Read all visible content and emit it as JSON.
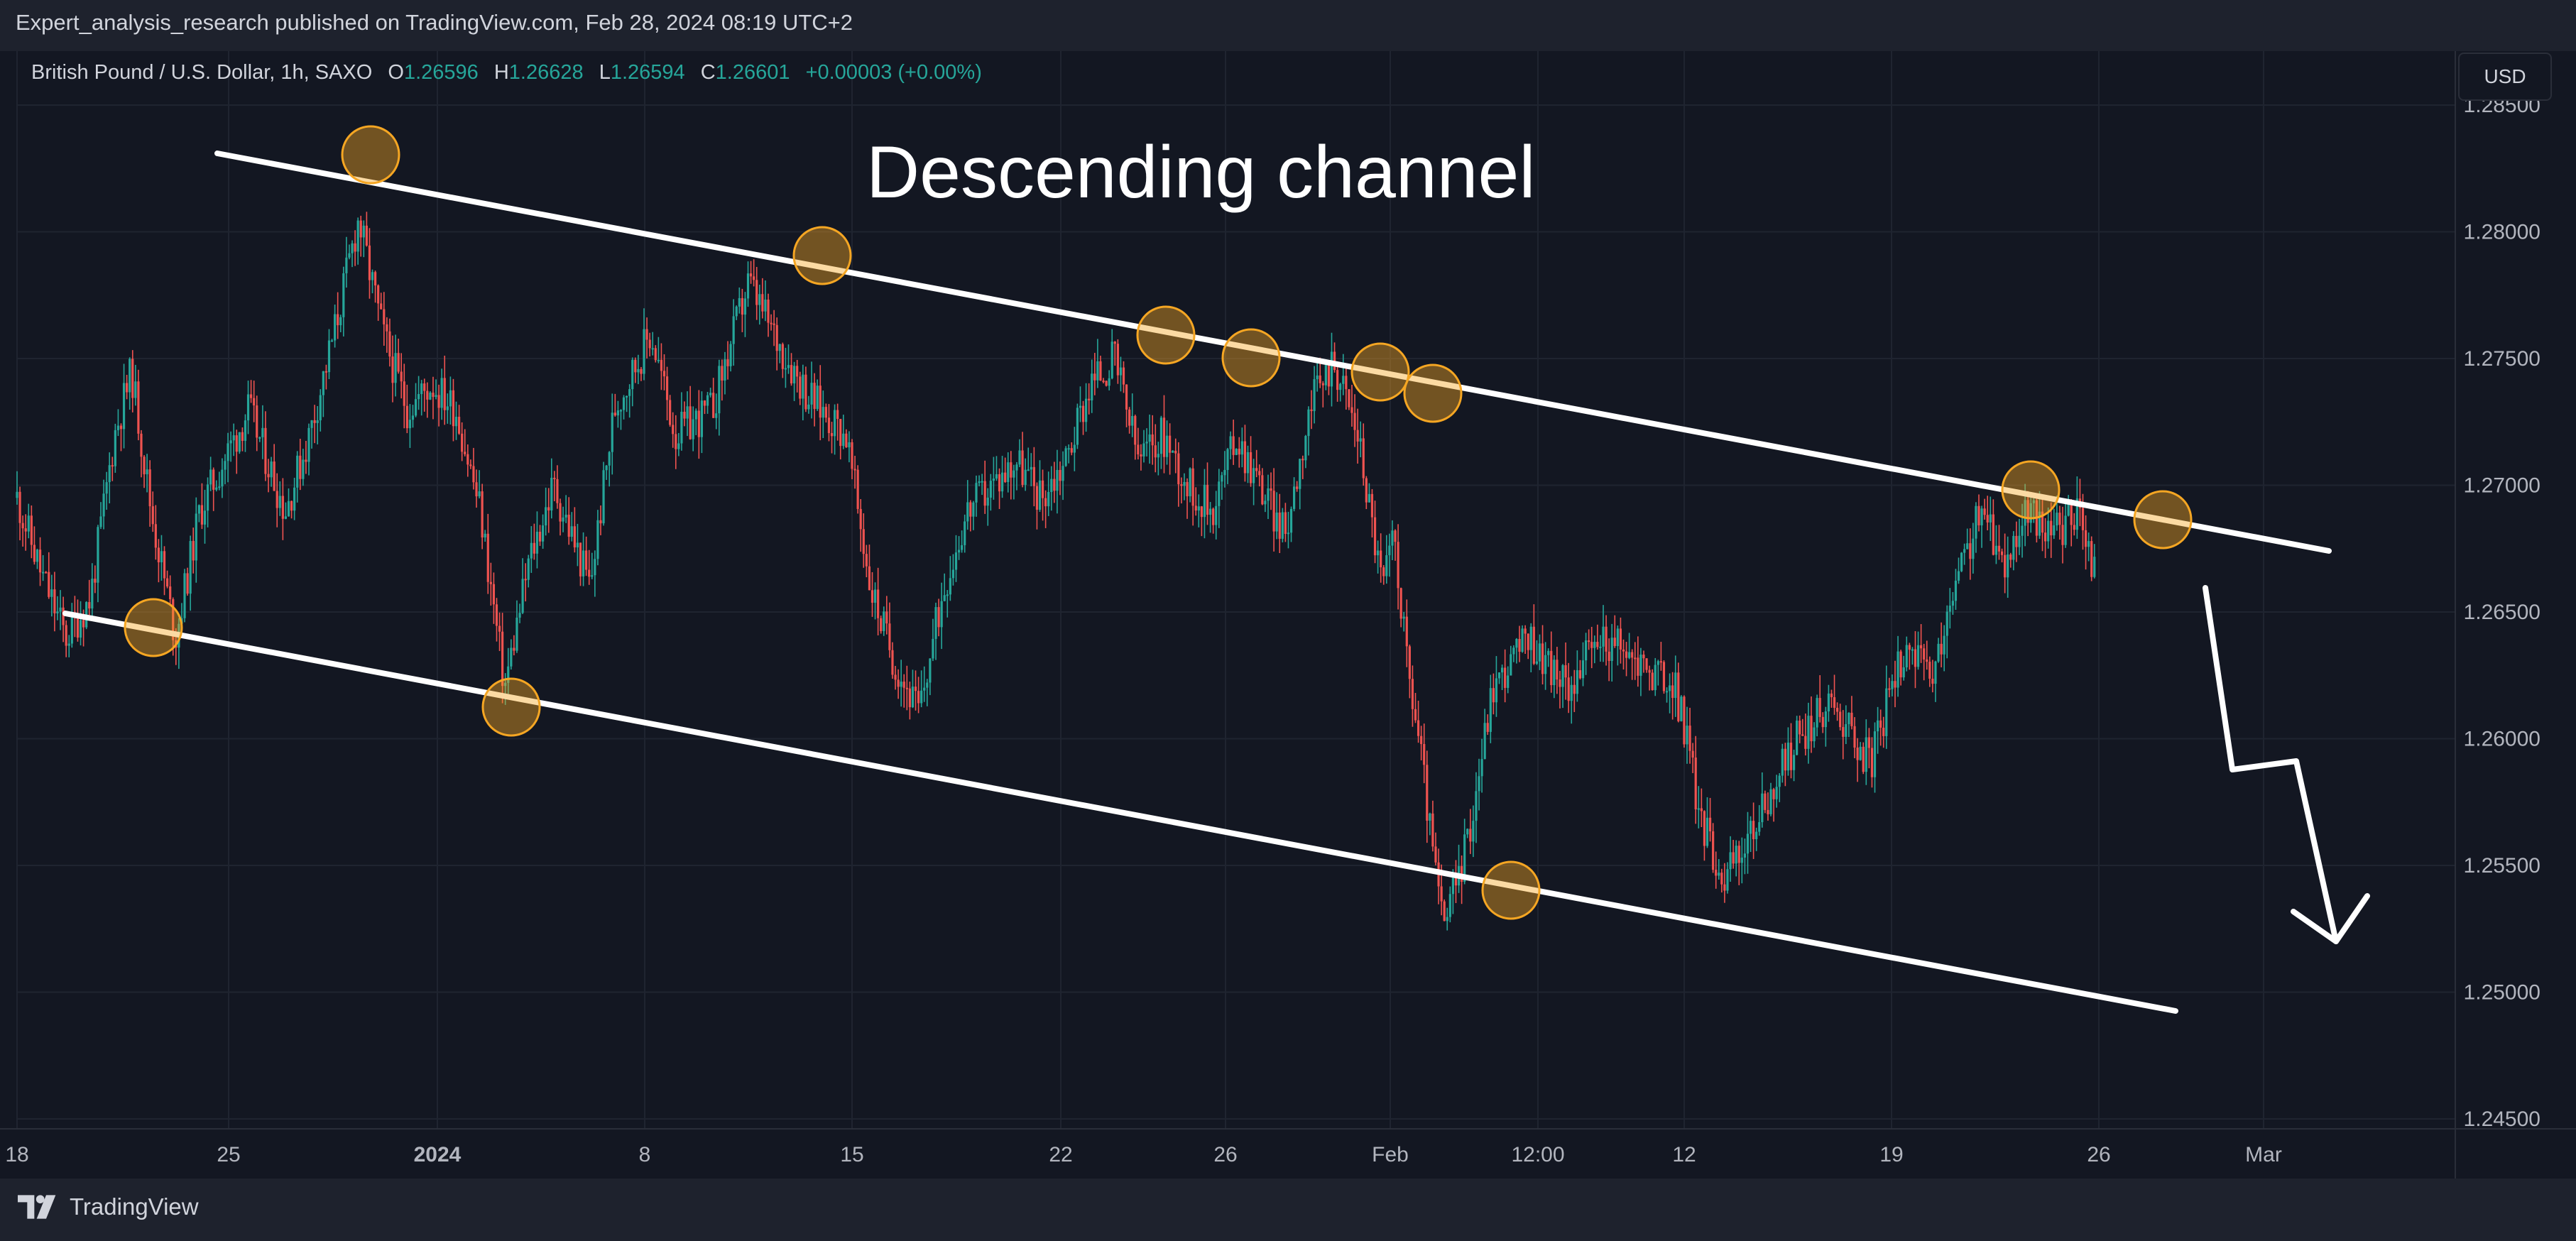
{
  "header": {
    "published": "Expert_analysis_research published on TradingView.com, Feb 28, 2024 08:19 UTC+2"
  },
  "legend": {
    "symbol": "British Pound / U.S. Dollar, 1h, SAXO",
    "open_label": "O",
    "open": "1.26596",
    "high_label": "H",
    "high": "1.26628",
    "low_label": "L",
    "low": "1.26594",
    "close_label": "C",
    "close": "1.26601",
    "change": "+0.00003 (+0.00%)"
  },
  "currency_button": "USD",
  "footer": {
    "brand": "TradingView"
  },
  "colors": {
    "background": "#131722",
    "bar": "#1e222d",
    "grid": "#1f2430",
    "axis_text": "#b2b5be",
    "up": "#26a69a",
    "down": "#ef5350",
    "trendline": "#ffffff",
    "marker": "#f5a623"
  },
  "icons": {
    "brand_logo": "tradingview-logo-icon"
  },
  "chart_data": {
    "type": "candlestick",
    "title": "Descending channel",
    "timeframe": "1h",
    "y_ticks": [
      "1.28500",
      "1.28000",
      "1.27500",
      "1.27000",
      "1.26500",
      "1.26000",
      "1.25500",
      "1.25000",
      "1.24500"
    ],
    "x_ticks": [
      {
        "label": "18",
        "bold": false
      },
      {
        "label": "25",
        "bold": false
      },
      {
        "label": "2024",
        "bold": true
      },
      {
        "label": "8",
        "bold": false
      },
      {
        "label": "15",
        "bold": false
      },
      {
        "label": "22",
        "bold": false
      },
      {
        "label": "26",
        "bold": false
      },
      {
        "label": "Feb",
        "bold": false
      },
      {
        "label": "12:00",
        "bold": false
      },
      {
        "label": "12",
        "bold": false
      },
      {
        "label": "19",
        "bold": false
      },
      {
        "label": "26",
        "bold": false
      },
      {
        "label": "Mar",
        "bold": false
      }
    ],
    "price_path": [
      [
        0,
        1.2695
      ],
      [
        0.01,
        1.2665
      ],
      [
        0.02,
        1.264
      ],
      [
        0.03,
        1.2655
      ],
      [
        0.04,
        1.272
      ],
      [
        0.047,
        1.2745
      ],
      [
        0.055,
        1.269
      ],
      [
        0.065,
        1.264
      ],
      [
        0.075,
        1.269
      ],
      [
        0.085,
        1.271
      ],
      [
        0.095,
        1.273
      ],
      [
        0.11,
        1.269
      ],
      [
        0.12,
        1.272
      ],
      [
        0.13,
        1.276
      ],
      [
        0.14,
        1.2805
      ],
      [
        0.15,
        1.276
      ],
      [
        0.16,
        1.273
      ],
      [
        0.17,
        1.274
      ],
      [
        0.18,
        1.273
      ],
      [
        0.19,
        1.269
      ],
      [
        0.2,
        1.262
      ],
      [
        0.21,
        1.267
      ],
      [
        0.22,
        1.27
      ],
      [
        0.235,
        1.266
      ],
      [
        0.245,
        1.273
      ],
      [
        0.26,
        1.276
      ],
      [
        0.27,
        1.272
      ],
      [
        0.285,
        1.273
      ],
      [
        0.3,
        1.278
      ],
      [
        0.31,
        1.276
      ],
      [
        0.325,
        1.2735
      ],
      [
        0.34,
        1.272
      ],
      [
        0.35,
        1.266
      ],
      [
        0.36,
        1.263
      ],
      [
        0.37,
        1.261
      ],
      [
        0.38,
        1.266
      ],
      [
        0.39,
        1.269
      ],
      [
        0.4,
        1.27
      ],
      [
        0.41,
        1.271
      ],
      [
        0.42,
        1.2695
      ],
      [
        0.43,
        1.271
      ],
      [
        0.44,
        1.274
      ],
      [
        0.45,
        1.275
      ],
      [
        0.46,
        1.271
      ],
      [
        0.47,
        1.272
      ],
      [
        0.48,
        1.27
      ],
      [
        0.49,
        1.269
      ],
      [
        0.5,
        1.272
      ],
      [
        0.51,
        1.27
      ],
      [
        0.52,
        1.268
      ],
      [
        0.53,
        1.273
      ],
      [
        0.54,
        1.275
      ],
      [
        0.55,
        1.272
      ],
      [
        0.56,
        1.266
      ],
      [
        0.565,
        1.268
      ],
      [
        0.57,
        1.263
      ],
      [
        0.575,
        1.26
      ],
      [
        0.58,
        1.256
      ],
      [
        0.585,
        1.2525
      ],
      [
        0.595,
        1.256
      ],
      [
        0.605,
        1.262
      ],
      [
        0.62,
        1.264
      ],
      [
        0.635,
        1.262
      ],
      [
        0.65,
        1.264
      ],
      [
        0.665,
        1.263
      ],
      [
        0.68,
        1.262
      ],
      [
        0.685,
        1.26
      ],
      [
        0.69,
        1.257
      ],
      [
        0.7,
        1.2545
      ],
      [
        0.71,
        1.256
      ],
      [
        0.72,
        1.258
      ],
      [
        0.73,
        1.26
      ],
      [
        0.745,
        1.2615
      ],
      [
        0.76,
        1.259
      ],
      [
        0.775,
        1.264
      ],
      [
        0.785,
        1.262
      ],
      [
        0.795,
        1.266
      ],
      [
        0.805,
        1.269
      ],
      [
        0.815,
        1.267
      ],
      [
        0.825,
        1.269
      ],
      [
        0.835,
        1.268
      ],
      [
        0.845,
        1.269
      ],
      [
        0.852,
        1.2665
      ]
    ]
  }
}
